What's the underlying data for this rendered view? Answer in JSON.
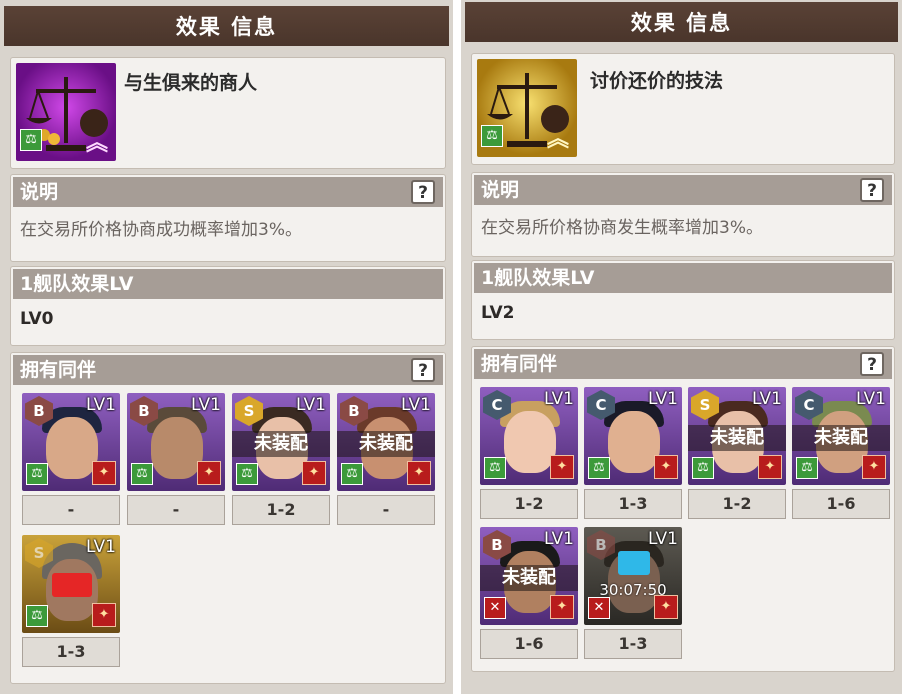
{
  "left": {
    "title": "效果 信息",
    "skill_name": "与生俱来的商人",
    "desc_header": "说明",
    "help": "?",
    "description": "在交易所价格协商成功概率增加3%。",
    "fleet_header": "1舰队效果LV",
    "fleet_level": "LV0",
    "companions_header": "拥有同伴",
    "companions": [
      {
        "grade": "B",
        "level": "LV1",
        "equip": "",
        "timer": "",
        "fleet": "-"
      },
      {
        "grade": "B",
        "level": "LV1",
        "equip": "",
        "timer": "",
        "fleet": "-"
      },
      {
        "grade": "S",
        "level": "LV1",
        "equip": "未装配",
        "timer": "",
        "fleet": "1-2"
      },
      {
        "grade": "B",
        "level": "LV1",
        "equip": "未装配",
        "timer": "",
        "fleet": "-"
      },
      {
        "grade": "S",
        "level": "LV1",
        "equip": "",
        "timer": "",
        "fleet": "1-3"
      }
    ]
  },
  "right": {
    "title": "效果 信息",
    "skill_name": "讨价还价的技法",
    "desc_header": "说明",
    "help": "?",
    "description": "在交易所价格协商发生概率增加3%。",
    "fleet_header": "1舰队效果LV",
    "fleet_level": "LV2",
    "companions_header": "拥有同伴",
    "companions": [
      {
        "grade": "C",
        "level": "LV1",
        "equip": "",
        "timer": "",
        "fleet": "1-2"
      },
      {
        "grade": "C",
        "level": "LV1",
        "equip": "",
        "timer": "",
        "fleet": "1-3"
      },
      {
        "grade": "S",
        "level": "LV1",
        "equip": "未装配",
        "timer": "",
        "fleet": "1-2"
      },
      {
        "grade": "C",
        "level": "LV1",
        "equip": "未装配",
        "timer": "",
        "fleet": "1-6"
      },
      {
        "grade": "B",
        "level": "LV1",
        "equip": "未装配",
        "timer": "",
        "fleet": "1-6"
      },
      {
        "grade": "B",
        "level": "LV1",
        "equip": "",
        "timer": "30:07:50",
        "fleet": "1-3"
      }
    ]
  },
  "colors": {
    "title_bg": "#4e392f",
    "header_bg": "#a69d96",
    "card_bg": "#f3f1ee",
    "panel_bg": "#d9d4cd",
    "skill_icon_left": "#8a1fb0",
    "skill_icon_right": "#c9a11f"
  }
}
